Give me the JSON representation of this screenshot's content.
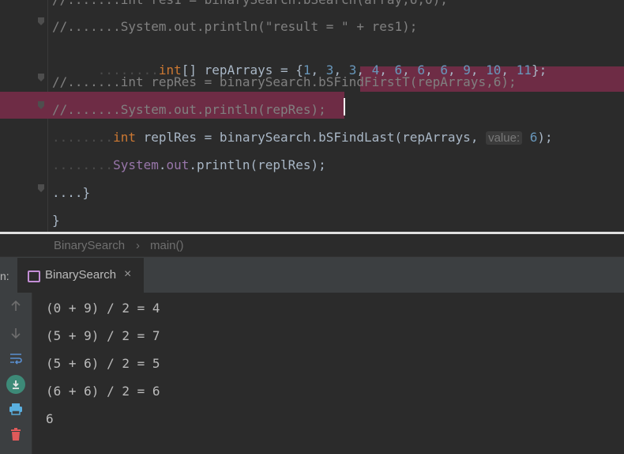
{
  "editor": {
    "lines": [
      {
        "id": "line0",
        "text": "//.......int res1 = binarySearch.bSearch(array,6,0);"
      },
      {
        "id": "line1",
        "text": "//.......System.out.println(\"result = \" + res1);"
      },
      {
        "id": "line2",
        "text": "........int[] repArrays = {1, 3, 3, 4, 6, 6, 6, 9, 10, 11};"
      },
      {
        "id": "line3",
        "text": "//.......int repRes = binarySearch.bSFindFirstT(repArrays,6);"
      },
      {
        "id": "line4",
        "text": "//.......System.out.println(repRes);"
      },
      {
        "id": "line5",
        "text": "........int replRes = binarySearch.bSFindLast(repArrays, value: 6);"
      },
      {
        "id": "line6",
        "text": "........System.out.println(replRes);"
      },
      {
        "id": "line7",
        "text": "....}"
      },
      {
        "id": "line8",
        "text": "}"
      }
    ],
    "param_hint": "value:"
  },
  "breadcrumb": {
    "class_name": "BinarySearch",
    "separator": "›",
    "method": "main()"
  },
  "run_panel": {
    "prefix": "n:",
    "tab_label": "BinarySearch",
    "tab_close": "×"
  },
  "console": {
    "output": [
      "(0 + 9) / 2 = 4",
      "(5 + 9) / 2 = 7",
      "(5 + 6) / 2 = 5",
      "(6 + 6) / 2 = 6",
      "6"
    ]
  },
  "toolbar_icons": [
    "up-arrow-icon",
    "down-arrow-icon",
    "soft-wrap-icon",
    "scroll-to-end-icon",
    "print-icon",
    "trash-icon"
  ],
  "colors": {
    "keyword": "#cc7832",
    "number": "#6897bb",
    "comment": "#808080",
    "field": "#9876aa",
    "highlight": "#6e2c45",
    "tab_icon": "#c38ed6"
  }
}
